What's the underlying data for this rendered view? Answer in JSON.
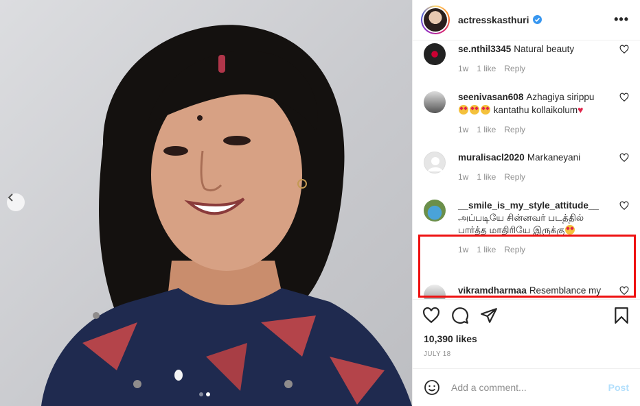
{
  "post": {
    "username": "actresskasthuri",
    "verified": true,
    "more_label": "•••",
    "likes_text": "10,390 likes",
    "date": "JULY 18",
    "images_count": 2,
    "active_image": 1
  },
  "comments": [
    {
      "user": "se.nthil3345",
      "text": "Natural beauty",
      "time": "1w",
      "likes": "1 like",
      "reply": "Reply"
    },
    {
      "user": "seenivasan608",
      "text": "Azhagiya sirippu",
      "text2": "kantathu kollaikolum",
      "time": "1w",
      "likes": "1 like",
      "reply": "Reply"
    },
    {
      "user": "muralisacl2020",
      "text": "Markaneyani",
      "time": "1w",
      "likes": "1 like",
      "reply": "Reply"
    },
    {
      "user": "__smile_is_my_style_attitude__",
      "text": "அப்படியே சின்னவர் படத்தில் பார்த்த மாதிரியே இருக்கு",
      "time": "1w",
      "likes": "1 like",
      "reply": "Reply"
    },
    {
      "user": "vikramdharmaa",
      "text": "Resemblance my",
      "time": "",
      "likes": "",
      "reply": ""
    }
  ],
  "add_comment": {
    "placeholder": "Add a comment...",
    "post_label": "Post"
  },
  "colors": {
    "accent": "#0095f6",
    "highlight": "#e11111",
    "verified": "#3897f0"
  },
  "icons": [
    "chevron-left-icon",
    "verified-badge-icon",
    "more-icon",
    "heart-icon",
    "comment-icon",
    "share-icon",
    "bookmark-icon",
    "smile-icon"
  ]
}
